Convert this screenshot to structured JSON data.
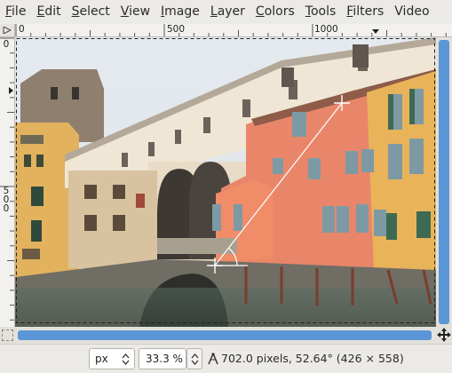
{
  "menubar": {
    "items": [
      {
        "label": "File",
        "accel": "F",
        "rest": "ile"
      },
      {
        "label": "Edit",
        "accel": "E",
        "rest": "dit"
      },
      {
        "label": "Select",
        "accel": "S",
        "rest": "elect"
      },
      {
        "label": "View",
        "accel": "V",
        "rest": "iew"
      },
      {
        "label": "Image",
        "accel": "I",
        "rest": "mage"
      },
      {
        "label": "Layer",
        "accel": "L",
        "rest": "ayer"
      },
      {
        "label": "Colors",
        "accel": "C",
        "rest": "olors"
      },
      {
        "label": "Tools",
        "accel": "T",
        "rest": "ools"
      },
      {
        "label": "Filters",
        "accel": "F",
        "rest": "ilters"
      },
      {
        "label": "Video",
        "accel": "",
        "rest": "Video"
      }
    ]
  },
  "rulers": {
    "horizontal": {
      "labels": [
        "0",
        "500",
        "1000"
      ]
    },
    "vertical": {
      "labels": [
        "0",
        "500"
      ]
    }
  },
  "statusbar": {
    "unit": "px",
    "zoom": "33.3 %",
    "measure": "702.0 pixels, 52.64° (426 × 558)"
  },
  "colors": {
    "accent": "#5b97d6",
    "wall_orange": "#e9866a",
    "sky": "#e9eef2",
    "river": "#556a5f"
  },
  "icons": {
    "corner": "quick-mask-toggle-icon",
    "nav": "navigate-icon",
    "measure": "compass-measure-icon"
  }
}
